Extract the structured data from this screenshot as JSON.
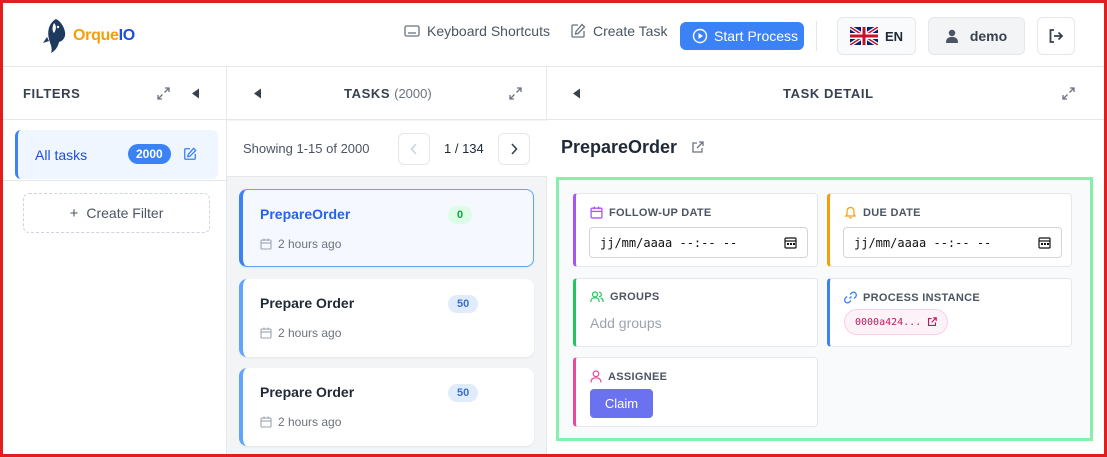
{
  "header": {
    "logo_text_a": "Orque",
    "logo_text_b": "IO",
    "keyboard_shortcuts_label": "Keyboard Shortcuts",
    "create_task_label": "Create Task",
    "start_process_label": "Start Process",
    "language_label": "EN",
    "user_label": "demo",
    "icons": [
      "orca-logo-icon",
      "keyboard-icon",
      "edit-icon",
      "play-circle-icon",
      "uk-flag-icon",
      "user-icon",
      "logout-icon"
    ]
  },
  "filters": {
    "title": "FILTERS",
    "items": [
      {
        "label": "All tasks",
        "count": "2000"
      }
    ],
    "create_filter_label": "Create Filter"
  },
  "tasks": {
    "title": "TASKS",
    "count": "(2000)",
    "showing_text": "Showing 1-15 of 2000",
    "page_indicator": "1 / 134",
    "items": [
      {
        "name": "PrepareOrder",
        "badge": "0",
        "time": "2 hours ago"
      },
      {
        "name": "Prepare Order",
        "badge": "50",
        "time": "2 hours ago"
      },
      {
        "name": "Prepare Order",
        "badge": "50",
        "time": "2 hours ago"
      }
    ]
  },
  "detail": {
    "panel_title": "TASK DETAIL",
    "task_title": "PrepareOrder",
    "follow_up_label": "FOLLOW-UP DATE",
    "follow_up_value": "jj/mm/aaaa --:-- --",
    "due_label": "DUE DATE",
    "due_value": "jj/mm/aaaa --:-- --",
    "groups_label": "GROUPS",
    "groups_placeholder": "Add groups",
    "process_instance_label": "PROCESS INSTANCE",
    "process_instance_value": "0000a424...",
    "assignee_label": "ASSIGNEE",
    "claim_label": "Claim"
  },
  "colors": {
    "accent": "#3b82f6",
    "follow_up_border": "#a855f7",
    "due_border": "#f59e0b",
    "groups_border": "#22c55e",
    "process_border": "#3b82f6",
    "assignee_border": "#ec4899",
    "highlight_frame": "#e11d1d",
    "highlight_box": "#86efac"
  }
}
